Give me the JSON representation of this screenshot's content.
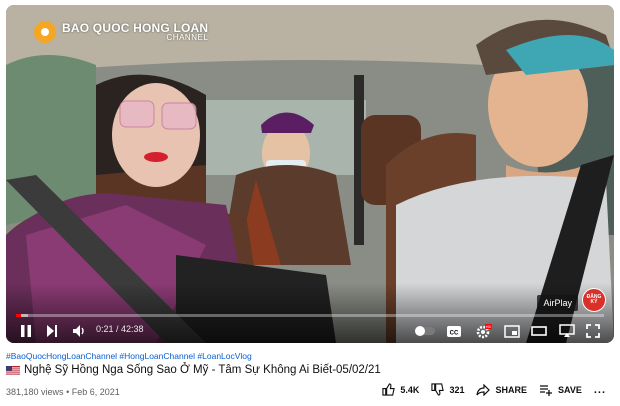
{
  "player": {
    "channel_logo": {
      "name": "BAO QUOC HONG LOAN",
      "subtitle": "CHANNEL"
    },
    "airplay_label": "AirPlay",
    "subscribe_badge": "ĐĂNG KÝ",
    "time_display": "0:21 / 42:38",
    "progress_fraction": 0.008,
    "buffered_fraction": 0.02,
    "icons": [
      "play-pause-icon",
      "next-icon",
      "volume-icon",
      "autoplay-toggle-icon",
      "captions-icon",
      "settings-icon",
      "miniplayer-icon",
      "theater-icon",
      "cast-icon",
      "fullscreen-icon"
    ],
    "hd_badge": "HD"
  },
  "video": {
    "hashtags": "#BaoQuocHongLoanChannel #HongLoanChannel #LoanLocVlog",
    "title": "Nghệ Sỹ Hồng Nga Sống Sao Ở Mỹ - Tâm Sự Không Ai Biết-05/02/21",
    "views": "381,180 views",
    "date": "Feb 6, 2021",
    "likes": "5.4K",
    "dislikes": "321",
    "share_label": "SHARE",
    "save_label": "SAVE",
    "more_label": "...",
    "accent": "#ff0000",
    "link_color": "#065fd4"
  }
}
